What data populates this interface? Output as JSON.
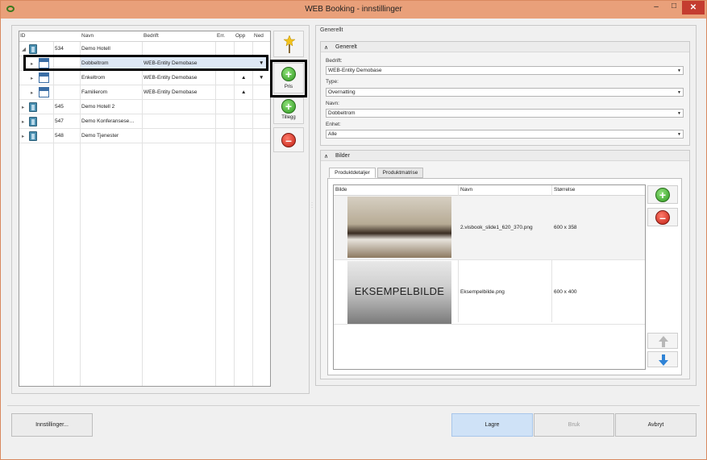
{
  "window": {
    "title": "WEB Booking - innstillinger",
    "min": "–",
    "max": "□",
    "close": "✕"
  },
  "tree": {
    "columns": [
      "ID",
      "Navn",
      "Bedrift",
      "Err.",
      "Opp",
      "Ned"
    ],
    "rows": [
      {
        "id": "534",
        "name": "Demo Hotell",
        "company": "",
        "expand": "◢"
      },
      {
        "id": "",
        "name": "Dobbeltrom",
        "company": "WEB-Entity Demobase",
        "ned": "▼"
      },
      {
        "id": "",
        "name": "Enkeltrom",
        "company": "WEB-Entity Demobase",
        "opp": "▲",
        "ned": "▼"
      },
      {
        "id": "",
        "name": "Familierom",
        "company": "WEB-Entity Demobase",
        "opp": "▲"
      },
      {
        "id": "545",
        "name": "Demo Hotell 2",
        "company": ""
      },
      {
        "id": "547",
        "name": "Demo Konferansese…",
        "company": ""
      },
      {
        "id": "548",
        "name": "Demo Tjenester",
        "company": ""
      }
    ]
  },
  "side_buttons": {
    "pris": "Pris",
    "tillegg": "Tillegg",
    "plus": "+",
    "minus": "–"
  },
  "right": {
    "section": "Generellt",
    "general_group": "Generelt",
    "fields": [
      {
        "label": "Bedrift:",
        "value": "WEB-Entity Demobase"
      },
      {
        "label": "Type:",
        "value": "Overnatting"
      },
      {
        "label": "Navn:",
        "value": "Dobbeltrom"
      },
      {
        "label": "Enhet:",
        "value": "Alle"
      }
    ],
    "images_group": "Bilder",
    "tabs": [
      "Produktdetaljer",
      "Produktmatrise"
    ],
    "image_columns": [
      "Bilde",
      "Navn",
      "Størrelse"
    ],
    "images": [
      {
        "name": "2.visbook_slide1_620_370.png",
        "size": "600 x 358"
      },
      {
        "name": "Eksempelbilde.png",
        "size": "600 x 400",
        "watermark": "EKSEMPELBILDE"
      }
    ],
    "collapse": "∧"
  },
  "footer": {
    "settings": "Innstillinger...",
    "save": "Lagre",
    "apply": "Bruk",
    "cancel": "Avbryt"
  },
  "dropdown_arrow": "▼"
}
